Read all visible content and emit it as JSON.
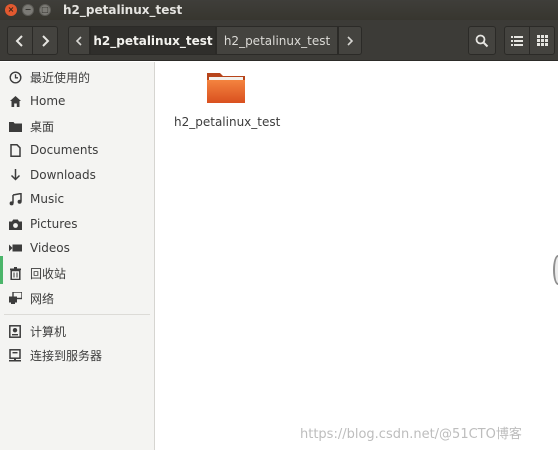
{
  "window": {
    "title": "h2_petalinux_test",
    "close_glyph": "×",
    "minimize_glyph": "−",
    "maximize_glyph": "□"
  },
  "toolbar": {
    "breadcrumbs": [
      "h2_petalinux_test",
      "h2_petalinux_test"
    ],
    "icons": [
      "chevron-left-icon",
      "chevron-right-icon",
      "chevron-left-icon",
      "chevron-right-icon",
      "search-icon",
      "list-view-icon",
      "grid-view-icon"
    ]
  },
  "sidebar": {
    "items": [
      {
        "label": "最近使用的",
        "icon": "clock-icon"
      },
      {
        "label": "Home",
        "icon": "home-icon"
      },
      {
        "label": "桌面",
        "icon": "folder-icon"
      },
      {
        "label": "Documents",
        "icon": "document-icon"
      },
      {
        "label": "Downloads",
        "icon": "download-icon"
      },
      {
        "label": "Music",
        "icon": "music-icon"
      },
      {
        "label": "Pictures",
        "icon": "camera-icon"
      },
      {
        "label": "Videos",
        "icon": "video-icon"
      },
      {
        "label": "回收站",
        "icon": "trash-icon"
      },
      {
        "label": "网络",
        "icon": "network-icon"
      },
      {
        "label": "计算机",
        "icon": "computer-icon"
      },
      {
        "label": "连接到服务器",
        "icon": "server-icon"
      }
    ]
  },
  "main": {
    "files": [
      {
        "name": "h2_petalinux_test",
        "type": "folder"
      }
    ]
  },
  "watermark": "https://blog.csdn.net/@51CTO博客",
  "colors": {
    "titlebar": "#3c3b37",
    "close_button": "#e2592f",
    "folder": "#e9662c",
    "sidebar": "#f4f4f2"
  }
}
